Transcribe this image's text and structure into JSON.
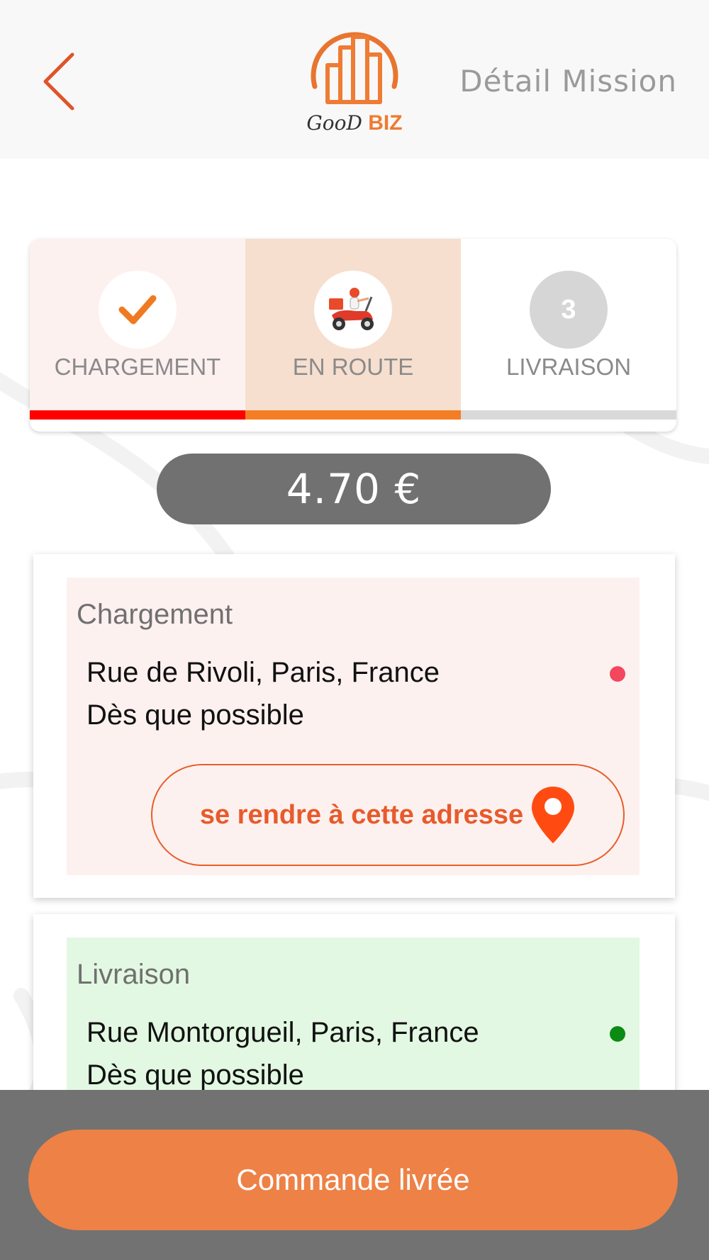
{
  "header": {
    "back_icon": "chevron-left-icon",
    "logo": {
      "good": "GooD",
      "biz": "BIZ"
    },
    "title": "Détail Mission"
  },
  "stepper": {
    "steps": [
      {
        "label": "CHARGEMENT",
        "icon": "check-icon",
        "status": "done"
      },
      {
        "label": "EN ROUTE",
        "icon": "scooter-courier-icon",
        "status": "current"
      },
      {
        "label": "LIVRAISON",
        "number": "3",
        "status": "pending"
      }
    ],
    "colors": {
      "done": "#ff0000",
      "current": "#f57d23",
      "pending": "#d9d9d9"
    }
  },
  "price": "4.70 €",
  "pickup": {
    "title": "Chargement",
    "address": "Rue de Rivoli, Paris, France",
    "time": "Dès que possible",
    "status_color": "#f2475c",
    "button_label": "se rendre à cette adresse",
    "button_icon": "map-pin-icon"
  },
  "delivery": {
    "title": "Livraison",
    "address": "Rue Montorgueil, Paris, France",
    "time": "Dès que possible",
    "status_color": "#0b8a14"
  },
  "footer": {
    "button_label": "Commande livrée",
    "accent": "#ee8146"
  }
}
